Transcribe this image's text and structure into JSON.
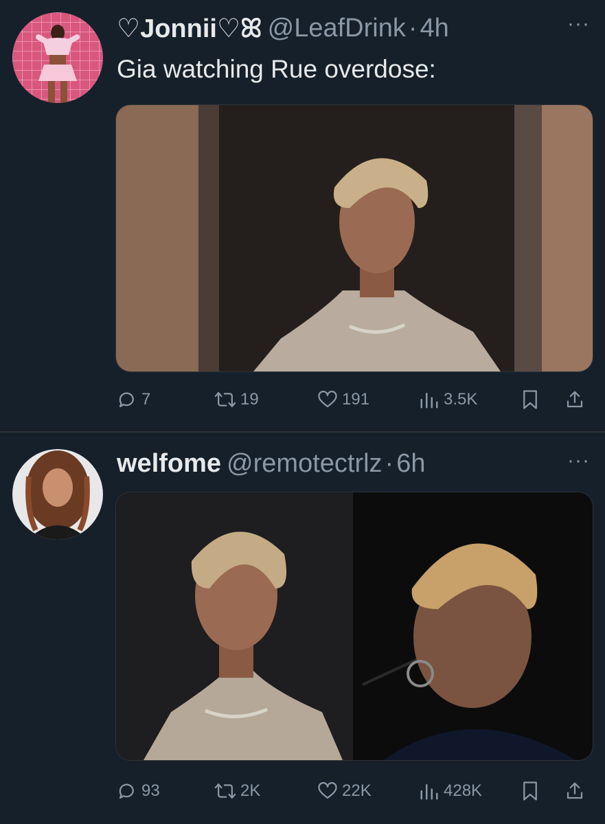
{
  "tweets": [
    {
      "display_name": "♡Jonnii♡ꕤ",
      "handle": "@LeafDrink",
      "separator": "·",
      "time": "4h",
      "more": "···",
      "text": "Gia watching Rue overdose:",
      "stats": {
        "replies": "7",
        "retweets": "19",
        "likes": "191",
        "views": "3.5K"
      }
    },
    {
      "display_name": "welfome",
      "handle": "@remotectrlz",
      "separator": "·",
      "time": "6h",
      "more": "···",
      "stats": {
        "replies": "93",
        "retweets": "2K",
        "likes": "22K",
        "views": "428K"
      }
    }
  ],
  "icons": [
    "reply-icon",
    "retweet-icon",
    "like-icon",
    "views-icon",
    "bookmark-icon",
    "share-icon",
    "more-icon"
  ],
  "colors": {
    "background": "#15202b",
    "text": "#e7e9ea",
    "secondary": "#8b98a5",
    "divider": "#2f3336"
  }
}
